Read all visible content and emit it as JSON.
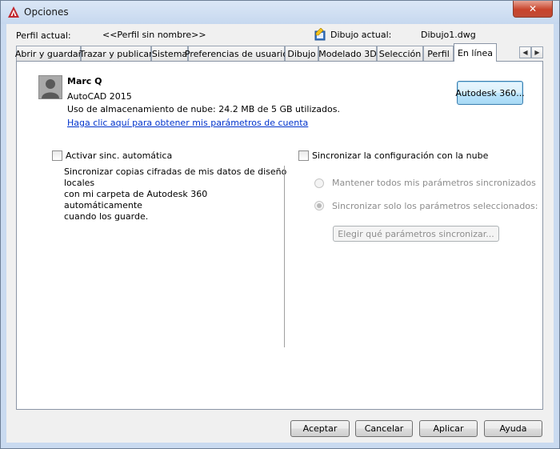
{
  "window": {
    "title": "Opciones",
    "close_glyph": "✕"
  },
  "header": {
    "profile_label": "Perfil actual:",
    "profile_value": "<<Perfil sin nombre>>",
    "drawing_label": "Dibujo actual:",
    "drawing_value": "Dibujo1.dwg"
  },
  "tabs": [
    "Abrir y guardar",
    "Trazar y publicar",
    "Sistema",
    "Preferencias de usuario",
    "Dibujo",
    "Modelado 3D",
    "Selección",
    "Perfil",
    "En línea"
  ],
  "active_tab": "En línea",
  "account": {
    "name": "Marc Q",
    "product": "AutoCAD 2015",
    "storage": "Uso de almacenamiento de nube: 24.2 MB de 5 GB utilizados.",
    "link": "Haga clic aquí para obtener mis parámetros de cuenta",
    "a360_button": "Autodesk 360..."
  },
  "left": {
    "checkbox_label": "Activar sinc. automática",
    "description": [
      "Sincronizar copias cifradas de mis datos de diseño locales",
      "con mi carpeta de Autodesk 360 automáticamente",
      "cuando los guarde."
    ]
  },
  "right": {
    "checkbox_label": "Sincronizar la configuración con la nube",
    "radio_all": "Mantener todos mis parámetros sincronizados",
    "radio_selected": "Sincronizar solo los parámetros seleccionados:",
    "choose_button": "Elegir qué parámetros sincronizar..."
  },
  "footer": {
    "accept": "Aceptar",
    "cancel": "Cancelar",
    "apply": "Aplicar",
    "help": "Ayuda"
  },
  "colors": {
    "link": "#0033cc",
    "title_bar": "#c9daf0",
    "close_button": "#c8442c"
  }
}
